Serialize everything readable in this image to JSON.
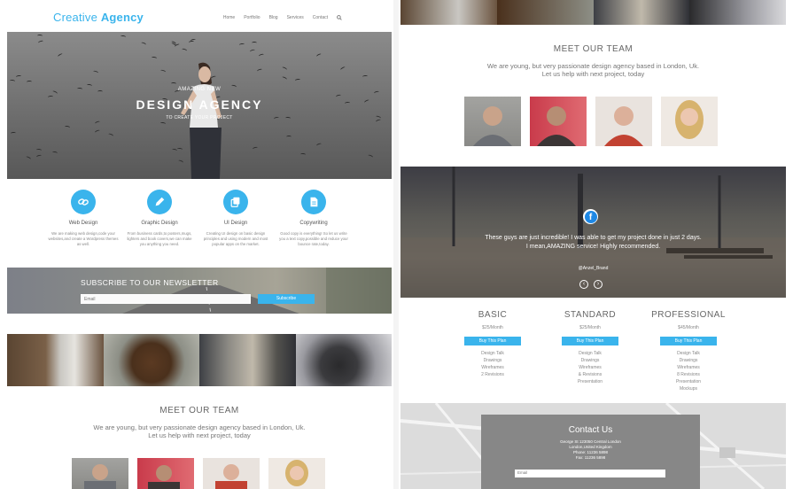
{
  "brand": {
    "name_part1": "Creative",
    "name_part2": "Agency",
    "color": "#3ab4ec"
  },
  "nav": {
    "items": [
      "Home",
      "Portfolio",
      "Blog",
      "Services",
      "Contact"
    ],
    "search_icon": "search-icon"
  },
  "hero": {
    "subtitle": "AMAZING NEW",
    "title": "DESIGN AGENCY",
    "cta": "TO CREATE YOUR PROJECT"
  },
  "services": [
    {
      "icon": "link-icon",
      "title": "Web Design",
      "desc": "We are making web design,code your websites,and create a Wordpress themes as well."
    },
    {
      "icon": "pencil-icon",
      "title": "Graphic Design",
      "desc": "From business cards,to posters,mugs, lighters and book covers,we can make you anything you need."
    },
    {
      "icon": "copy-icon",
      "title": "UI Design",
      "desc": "Creating UI design on basic design principles and using modern and most popular apps on the market."
    },
    {
      "icon": "document-icon",
      "title": "Copywriting",
      "desc": "Good copy is everything! So let us write you a text copy,possible and reduce your bounce rate,today."
    }
  ],
  "newsletter": {
    "title": "SUBSCRIBE TO OUR NEWSLETTER",
    "placeholder": "Email",
    "button": "Subscribe"
  },
  "team": {
    "title": "MEET OUR TEAM",
    "desc_line1": "We are young, but very passionate design agency based in London, Uk.",
    "desc_line2": "Let us help with next project, today"
  },
  "testimonial": {
    "quote_line1": "These guys are just incredible! I was able to get my project done in just 2 days.",
    "quote_line2": "I mean,AMAZING service! Highly recommended.",
    "author": "@Anzel_Brand",
    "icon": "facebook-icon"
  },
  "pricing": [
    {
      "name": "BASIC",
      "price": "$25/Month",
      "button": "Buy This Plan",
      "features": [
        "Design Talk",
        "Drawings",
        "Wireframes",
        "2 Revisions"
      ]
    },
    {
      "name": "STANDARD",
      "price": "$25/Month",
      "button": "Buy This Plan",
      "features": [
        "Design Talk",
        "Drawings",
        "Wireframes",
        "& Revisions",
        "Presentation"
      ]
    },
    {
      "name": "PROFESSIONAL",
      "price": "$45/Month",
      "button": "Buy This Plan",
      "features": [
        "Design Talk",
        "Drawings",
        "Wireframes",
        "8 Revisions",
        "Presentation",
        "Mockups"
      ]
    }
  ],
  "contact": {
    "title": "Contact Us",
    "address1": "George St 123050 Central London",
    "address2": "London,United Kingdom",
    "phone": "Phone: 11236 5898",
    "fax": "Fax: 11236 5898",
    "email_placeholder": "Email"
  }
}
